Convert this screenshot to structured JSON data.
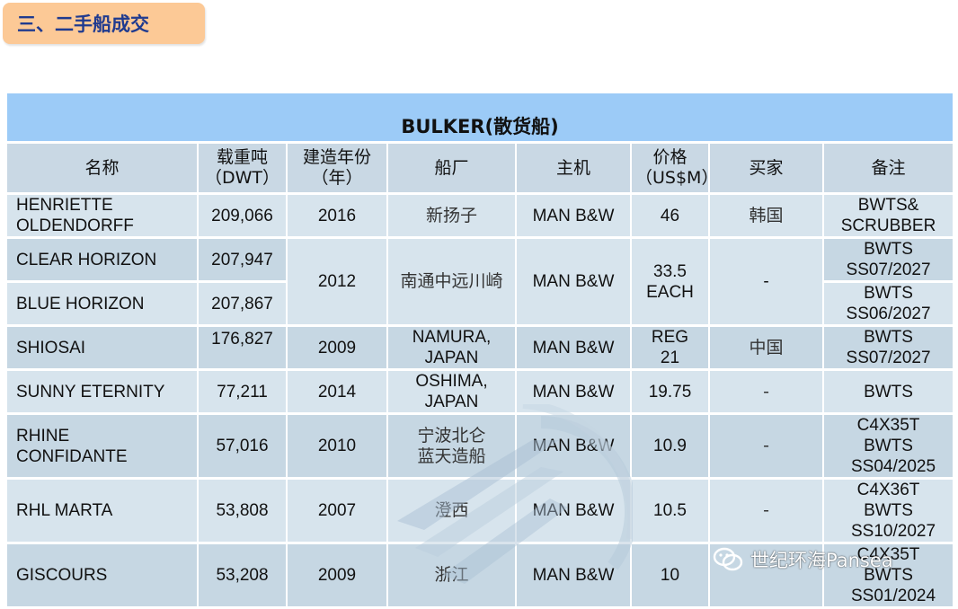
{
  "section": {
    "title": "三、二手船成交"
  },
  "table": {
    "title": "BULKER(散货船)",
    "headers": {
      "name": "名称",
      "dwt": "载重吨\n（DWT）",
      "built": "建造年份\n（年）",
      "yard": "船厂",
      "engine": "主机",
      "price": "价格\n（US$M）",
      "buyer": "买家",
      "remarks": "备注"
    },
    "rows": [
      {
        "name": "HENRIETTE OLDENDORFF",
        "dwt": "209,066",
        "built": "2016",
        "yard": "新扬子",
        "engine": "MAN B&W",
        "price": "46",
        "buyer": "韩国",
        "remarks": "BWTS& SCRUBBER"
      },
      {
        "name": "CLEAR HORIZON",
        "dwt": "207,947",
        "built": "2012",
        "yard": "南通中远川崎",
        "engine": "MAN B&W",
        "price": "33.5 EACH",
        "buyer": "-",
        "remarks": "BWTS SS07/2027"
      },
      {
        "name": "BLUE HORIZON",
        "dwt": "207,867",
        "remarks": "BWTS SS06/2027"
      },
      {
        "name": "SHIOSAI",
        "dwt": "176,827",
        "built": "2009",
        "yard": "NAMURA, JAPAN",
        "engine": "MAN B&W",
        "price": "REG 21",
        "buyer": "中国",
        "remarks": "BWTS SS07/2027"
      },
      {
        "name": "SUNNY ETERNITY",
        "dwt": "77,211",
        "built": "2014",
        "yard": "OSHIMA, JAPAN",
        "engine": "MAN B&W",
        "price": "19.75",
        "buyer": "-",
        "remarks": "BWTS"
      },
      {
        "name": "RHINE CONFIDANTE",
        "dwt": "57,016",
        "built": "2010",
        "yard": "宁波北仑 蓝天造船",
        "engine": "MAN B&W",
        "price": "10.9",
        "buyer": "-",
        "remarks": "C4X35T BWTS SS04/2025"
      },
      {
        "name": "RHL MARTA",
        "dwt": "53,808",
        "built": "2007",
        "yard": "澄西",
        "engine": "MAN B&W",
        "price": "10.5",
        "buyer": "-",
        "remarks": "C4X36T BWTS SS10/2027"
      },
      {
        "name": "GISCOURS",
        "dwt": "53,208",
        "built": "2009",
        "yard": "浙江",
        "engine": "MAN B&W",
        "price": "10",
        "buyer": "",
        "remarks": "C4X35T BWTS SS01/2024"
      }
    ]
  },
  "watermark": {
    "text": "世纪环海Pansea",
    "icon": "wechat-icon"
  },
  "colors": {
    "title_bar": "#9ccbf7",
    "header": "#c9d8e4",
    "row_light": "#d7e4ed",
    "row_dark": "#c6d7e3",
    "tag_bg": "#fcc996",
    "tag_text": "#1f3a8f"
  }
}
